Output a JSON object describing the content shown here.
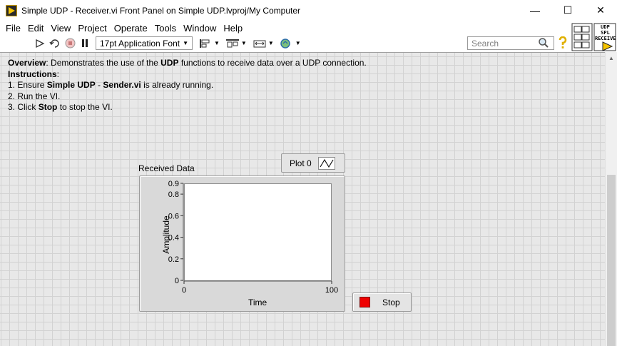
{
  "window": {
    "title": "Simple UDP - Receiver.vi Front Panel on Simple UDP.lvproj/My Computer",
    "controls": {
      "minimize": "—",
      "maximize": "☐",
      "close": "✕"
    }
  },
  "menu": {
    "items": [
      "File",
      "Edit",
      "View",
      "Project",
      "Operate",
      "Tools",
      "Window",
      "Help"
    ]
  },
  "toolbar": {
    "font_select": "17pt Application Font",
    "search_placeholder": "Search",
    "icons": [
      "run-arrow-icon",
      "run-continuously-icon",
      "abort-icon",
      "pause-icon",
      "align-objects-icon",
      "distribute-objects-icon",
      "resize-objects-icon",
      "reorder-icon",
      "search-icon",
      "help-icon"
    ],
    "vi_icon_text": "UDP SPL RECEIVE"
  },
  "panel": {
    "overview_label": "Overview",
    "overview_pre": ": Demonstrates the use of the ",
    "overview_bold": "UDP",
    "overview_post": " functions to receive data over a UDP connection.",
    "instructions_label": "Instructions",
    "instructions_colon": ":",
    "step1_pre": "1. Ensure ",
    "step1_bold1": "Simple UDP",
    "step1_mid": " - ",
    "step1_bold2": "Sender.vi",
    "step1_post": " is already running.",
    "step2": "2. Run the VI.",
    "step3_pre": "3. Click ",
    "step3_bold": "Stop",
    "step3_post": " to stop the VI."
  },
  "graph": {
    "label": "Received Data",
    "legend_label": "Plot 0"
  },
  "stop_button": {
    "label": "Stop",
    "led_color": "#ee0000"
  },
  "chart_data": {
    "type": "line",
    "title": "Received Data",
    "xlabel": "Time",
    "ylabel": "Amplitude",
    "xlim": [
      0,
      100
    ],
    "ylim": [
      0,
      0.9
    ],
    "x_ticks": [
      "0",
      "100"
    ],
    "y_ticks": [
      "0",
      "0.2",
      "0.4",
      "0.6",
      "0.8",
      "0.9"
    ],
    "y_tick_values": [
      0,
      0.2,
      0.4,
      0.6,
      0.8,
      0.9
    ],
    "series": [
      {
        "name": "Plot 0",
        "values": []
      }
    ]
  }
}
